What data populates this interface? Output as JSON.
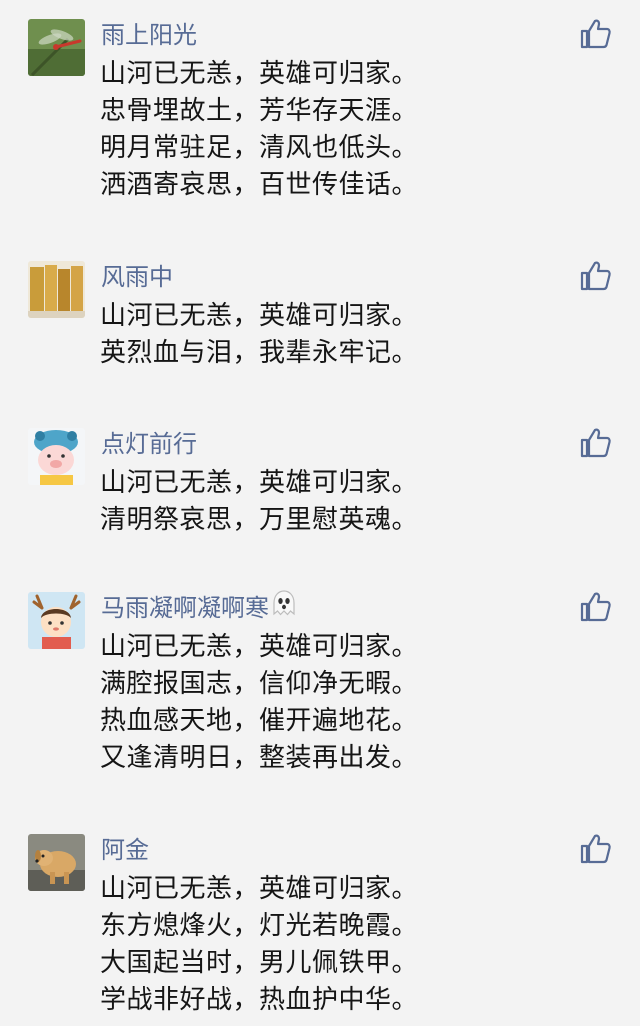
{
  "comments": [
    {
      "nickname": "雨上阳光",
      "avatar": "dragonfly-avatar-icon",
      "lines": [
        "山河已无恙，英雄可归家。",
        "忠骨埋故土，芳华存天涯。",
        "明月常驻足，清风也低头。",
        "洒酒寄哀思，百世传佳话。"
      ]
    },
    {
      "nickname": "风雨中",
      "avatar": "books-avatar-icon",
      "lines": [
        "山河已无恙，英雄可归家。",
        "英烈血与泪，我辈永牢记。"
      ]
    },
    {
      "nickname": "点灯前行",
      "avatar": "cartoon-pig-avatar-icon",
      "lines": [
        "山河已无恙，英雄可归家。",
        "清明祭哀思，万里慰英魂。"
      ]
    },
    {
      "nickname": "马雨凝啊凝啊寒",
      "nickname_emoji": "ghost-emoji-icon",
      "avatar": "cartoon-kid-antlers-avatar-icon",
      "lines": [
        "山河已无恙，英雄可归家。",
        "满腔报国志，信仰净无暇。",
        "热血感天地，催开遍地花。",
        "又逢清明日，整装再出发。"
      ]
    },
    {
      "nickname": "阿金",
      "avatar": "dog-avatar-icon",
      "lines": [
        "山河已无恙，英雄可归家。",
        "东方熄烽火，灯光若晚霞。",
        "大国起当时，男儿佩铁甲。",
        "学战非好战，热血护中华。"
      ]
    }
  ],
  "colors": {
    "background": "#f3f3f3",
    "nickname": "#576b95",
    "text": "#151515",
    "like_icon": "#576b95"
  }
}
